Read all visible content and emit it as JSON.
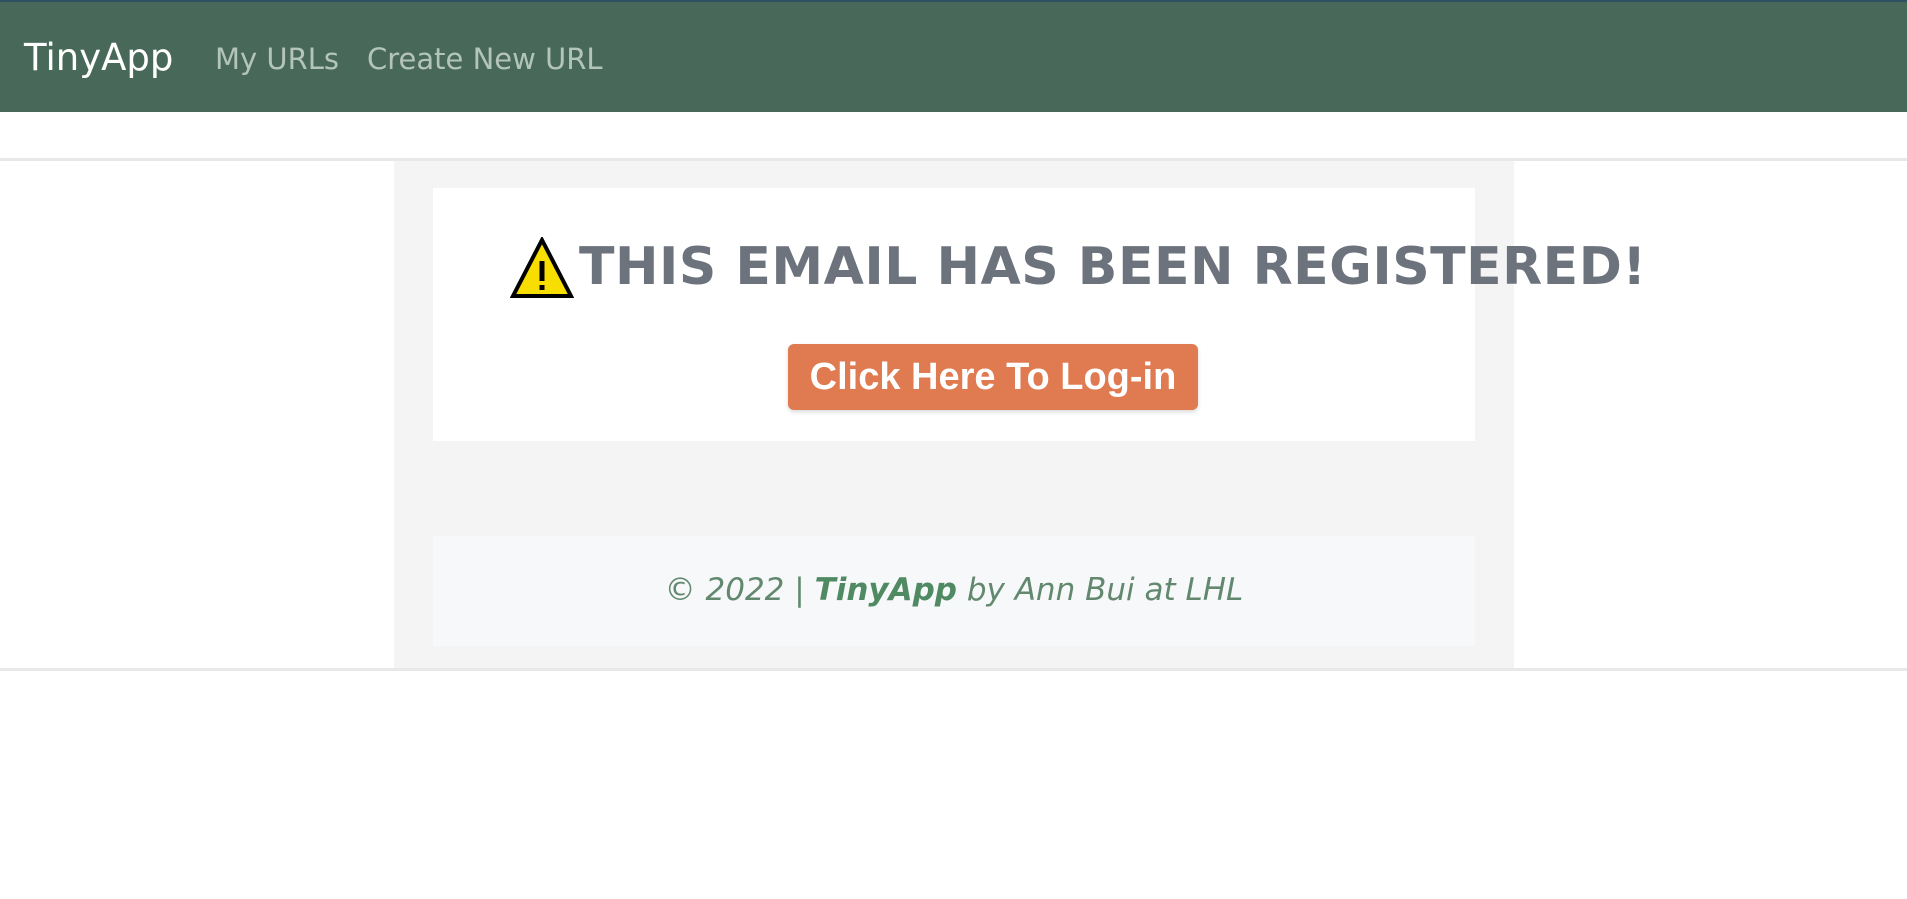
{
  "navbar": {
    "brand": "TinyApp",
    "links": [
      {
        "label": "My URLs"
      },
      {
        "label": "Create New URL"
      }
    ],
    "background_color": "#48695a"
  },
  "main": {
    "warning_icon": "warning-triangle-icon",
    "headline": "THIS EMAIL HAS BEEN REGISTERED!",
    "login_button_label": "Click Here To Log-in",
    "button_color": "#e07a50"
  },
  "footer": {
    "prefix": "© 2022 |",
    "brand": "TinyApp",
    "suffix": "by Ann Bui at LHL"
  }
}
